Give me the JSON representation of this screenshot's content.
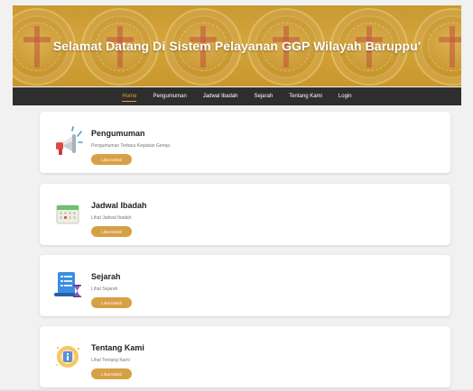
{
  "banner": {
    "title": "Selamat Datang Di Sistem Pelayanan GGP Wilayah Baruppu'",
    "seal_icon": "church-seal-icon",
    "colors": {
      "gold": "#c99a32",
      "title_text": "#ffffff"
    }
  },
  "nav": {
    "items": [
      {
        "label": "Home",
        "active": true
      },
      {
        "label": "Pengumuman",
        "active": false
      },
      {
        "label": "Jadwal Ibadah",
        "active": false
      },
      {
        "label": "Sejarah",
        "active": false
      },
      {
        "label": "Tentang Kami",
        "active": false
      },
      {
        "label": "Login",
        "active": false
      }
    ],
    "colors": {
      "background": "#2e2e2e",
      "active": "#d9a43a",
      "text": "#ffffff"
    }
  },
  "cards": [
    {
      "title": "Pengumuman",
      "description": "Pengumuman Terbaru Kegiatan Gereja",
      "button": "Lihat Detail",
      "icon": "megaphone-icon"
    },
    {
      "title": "Jadwal Ibadah",
      "description": "Lihat Jadwal Ibadah",
      "button": "Lihat Detail",
      "icon": "calendar-icon"
    },
    {
      "title": "Sejarah",
      "description": "Lihat Sejarah",
      "button": "Lihat Detail",
      "icon": "history-scroll-icon"
    },
    {
      "title": "Tentang Kami",
      "description": "Lihat Tentang Kami",
      "button": "Lihat Detail",
      "icon": "info-icon"
    }
  ],
  "colors": {
    "button": "#d6a144",
    "page_background": "#f1f1f1",
    "card_background": "#ffffff"
  }
}
